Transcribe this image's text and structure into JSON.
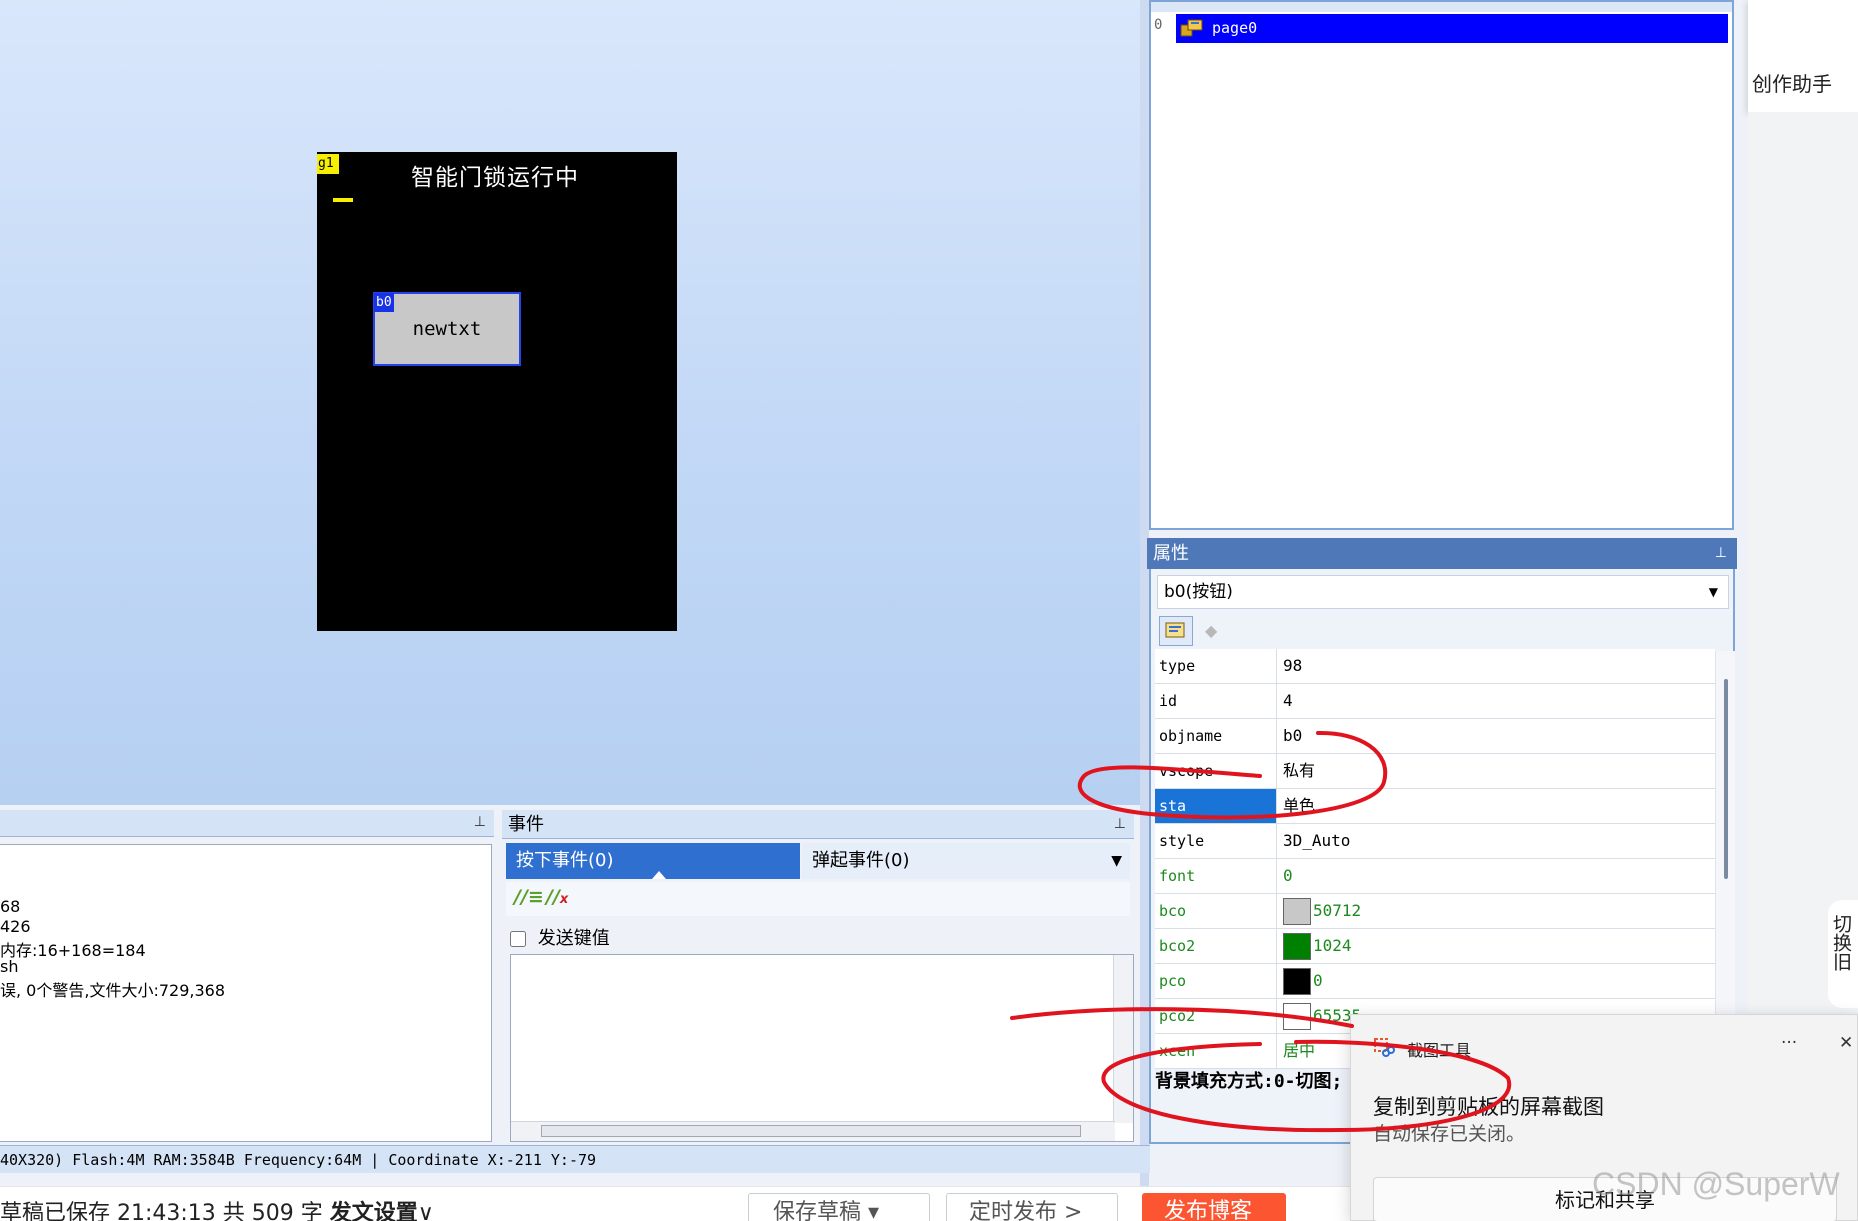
{
  "canvas": {
    "g1_tag": "g1",
    "title": "智能门锁运行中",
    "button_tag": "b0",
    "button_text": "newtxt"
  },
  "tree": {
    "row_index": "0",
    "page_name": "page0"
  },
  "assistant": {
    "label": "创作助手"
  },
  "side_tab": {
    "label": "切换旧"
  },
  "properties": {
    "header": "属性",
    "pin": "ꟷ",
    "object": "b0(按钮)",
    "rows": [
      {
        "name": "type",
        "value": "98"
      },
      {
        "name": "id",
        "value": "4"
      },
      {
        "name": "objname",
        "value": "b0"
      },
      {
        "name": "vscope",
        "value": "私有"
      },
      {
        "name": "sta",
        "value": "单色"
      },
      {
        "name": "style",
        "value": "3D_Auto"
      },
      {
        "name": "font",
        "value": "0"
      },
      {
        "name": "bco",
        "value": "50712",
        "color": "#c8c8c8"
      },
      {
        "name": "bco2",
        "value": "1024",
        "color": "#008000"
      },
      {
        "name": "pco",
        "value": "0",
        "color": "#000000"
      },
      {
        "name": "pco2",
        "value": "65535",
        "color": "#ffffff"
      },
      {
        "name": "xcen",
        "value": "居中"
      }
    ],
    "description": "背景填充方式:0-切图;"
  },
  "output": {
    "lines": [
      "68",
      "426",
      "内存:16+168=184",
      "sh",
      "误, 0个警告,文件大小:729,368"
    ]
  },
  "events": {
    "header": "事件",
    "tab_press": "按下事件(0)",
    "tab_release": "弹起事件(0)",
    "send_key_label": "发送键值"
  },
  "status_bar": {
    "text": "40X320) Flash:4M RAM:3584B Frequency:64M   |  Coordinate X:-211  Y:-79"
  },
  "bottom_bar": {
    "draft_saved": "草稿已保存 21:43:13 共 509 字",
    "settings": "发文设置",
    "save_draft": "保存草稿 ▾",
    "timed_publish": "定时发布 >",
    "publish": "发布博客"
  },
  "toast": {
    "app": "截图工具",
    "more": "···",
    "close": "✕",
    "title": "复制到剪贴板的屏幕截图",
    "subtitle": "自动保存已关闭。",
    "action": "标记和共享"
  },
  "watermark": "CSDN @SuperW",
  "colors": {
    "annotation_red": "#e0141e",
    "selection_blue": "#0000ff",
    "accent": "#fc5531"
  }
}
